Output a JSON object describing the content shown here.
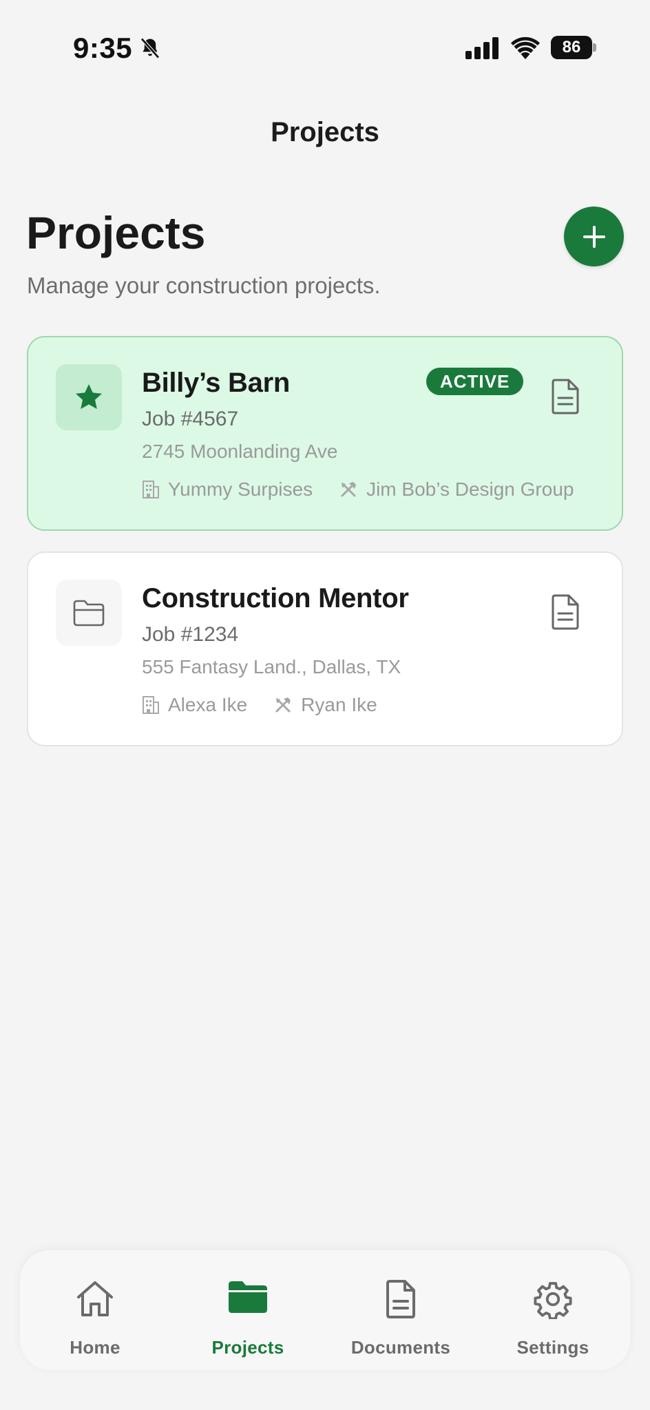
{
  "status_bar": {
    "time": "9:35",
    "battery": "86"
  },
  "nav": {
    "title": "Projects"
  },
  "header": {
    "heading": "Projects",
    "subtitle": "Manage your construction projects."
  },
  "projects": [
    {
      "name": "Billy’s Barn",
      "job": "Job #4567",
      "address": "2745 Moonlanding Ave",
      "client": "Yummy Surpises",
      "contractor": "Jim Bob’s Design Group",
      "badge": "ACTIVE",
      "icon": "star-icon"
    },
    {
      "name": "Construction Mentor",
      "job": "Job #1234",
      "address": "555 Fantasy Land., Dallas, TX",
      "client": "Alexa Ike",
      "contractor": "Ryan Ike",
      "icon": "folder-icon"
    }
  ],
  "tabs": [
    {
      "label": "Home",
      "icon": "home-icon"
    },
    {
      "label": "Projects",
      "icon": "folder-icon",
      "active": true
    },
    {
      "label": "Documents",
      "icon": "document-icon"
    },
    {
      "label": "Settings",
      "icon": "gear-icon"
    }
  ],
  "colors": {
    "accent": "#1a7a3c",
    "active_card_bg": "#dcf9e5",
    "background": "#f4f4f4"
  }
}
